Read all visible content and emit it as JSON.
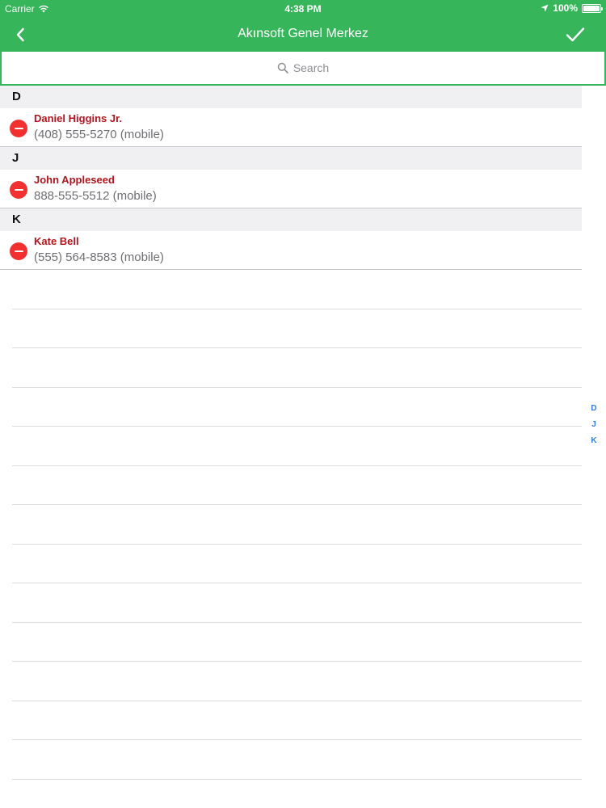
{
  "status": {
    "carrier": "Carrier",
    "time": "4:38 PM",
    "battery": "100%"
  },
  "nav": {
    "title": "Akınsoft Genel Merkez",
    "back_icon": "chevron-left-icon",
    "done_icon": "checkmark-icon"
  },
  "search": {
    "placeholder": "Search"
  },
  "sections": [
    {
      "letter": "D",
      "contacts": [
        {
          "name": "Daniel Higgins Jr.",
          "phone": "(408) 555-5270 (mobile)"
        }
      ]
    },
    {
      "letter": "J",
      "contacts": [
        {
          "name": "John Appleseed",
          "phone": "888-555-5512 (mobile)"
        }
      ]
    },
    {
      "letter": "K",
      "contacts": [
        {
          "name": "Kate Bell",
          "phone": "(555) 564-8583 (mobile)"
        }
      ]
    }
  ],
  "index": [
    "D",
    "J",
    "K"
  ],
  "colors": {
    "accent": "#37b55a",
    "delete": "#f33030",
    "name_text": "#b0151c",
    "index_text": "#2f7de1"
  }
}
